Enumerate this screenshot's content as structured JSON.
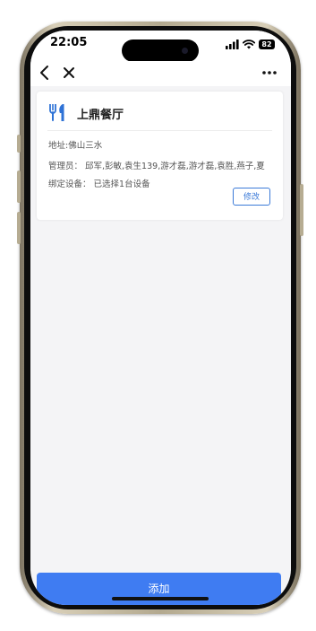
{
  "status_bar": {
    "time": "22:05",
    "battery": "82"
  },
  "nav": {
    "back_icon": "chevron-left-icon",
    "close_icon": "close-icon",
    "more_icon": "more-dots-icon"
  },
  "store": {
    "icon": "utensils-icon",
    "name": "上鼎餐厅",
    "address": "地址:佛山三水",
    "managers": "管理员： 邱军,彭敏,袁生139,游才磊,游才磊,袁胜,燕子,夏",
    "devices": "绑定设备： 已选择1台设备",
    "edit_label": "修改"
  },
  "footer": {
    "add_label": "添加"
  },
  "colors": {
    "accent": "#3f7cf2",
    "page_bg": "#f4f4f6"
  }
}
